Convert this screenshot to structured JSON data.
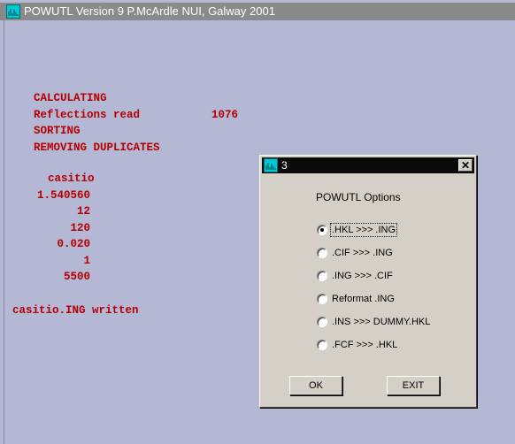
{
  "main_window": {
    "title": "POWUTL Version 9 P.McArdle NUI, Galway 2001"
  },
  "console": {
    "status_lines": [
      "CALCULATING",
      "Reflections read",
      "SORTING",
      "REMOVING DUPLICATES"
    ],
    "reflections_count": "1076",
    "name": "casitio",
    "values": [
      "1.540560",
      "12",
      "120",
      "0.020",
      "1",
      "5500"
    ],
    "written_message": "casitio.ING written"
  },
  "dialog": {
    "title": "3",
    "close_glyph": "✕",
    "heading": "POWUTL  Options",
    "options": [
      {
        "label": ".HKL >>> .ING",
        "selected": true
      },
      {
        "label": ".CIF >>> .ING",
        "selected": false
      },
      {
        "label": ".ING >>> .CIF",
        "selected": false
      },
      {
        "label": "Reformat .ING",
        "selected": false
      },
      {
        "label": ".INS >>> DUMMY.HKL",
        "selected": false
      },
      {
        "label": ".FCF >>> .HKL",
        "selected": false
      }
    ],
    "ok_label": "OK",
    "exit_label": "EXIT"
  }
}
